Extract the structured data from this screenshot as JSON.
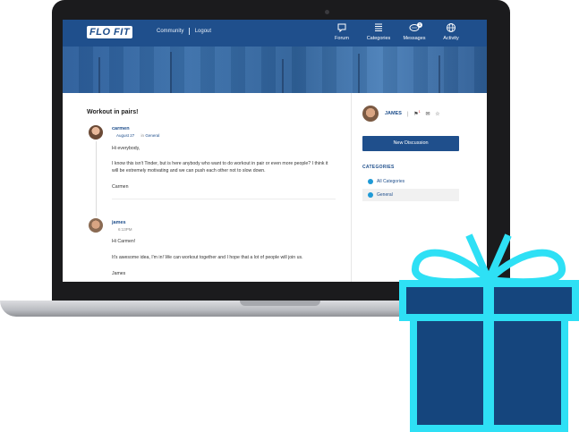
{
  "brand": {
    "logo": "FLO FIT"
  },
  "topnav": {
    "community": "Community",
    "logout": "Logout"
  },
  "iconnav": [
    {
      "label": "Forum",
      "icon": "chat-bubble-icon"
    },
    {
      "label": "Categories",
      "icon": "list-icon"
    },
    {
      "label": "Messages",
      "icon": "messages-icon",
      "badge": "1"
    },
    {
      "label": "Activity",
      "icon": "globe-icon"
    }
  ],
  "thread": {
    "title": "Workout in pairs!",
    "posts": [
      {
        "author": "carmen",
        "date": "August 27",
        "in_word": "in",
        "category": "General",
        "lines": [
          "Hi everybody,",
          "I know this isn't Tinder, but is here anybody who want to do workout in pair or even more people? I think it",
          "will be extremely motivating and we can push each other not to slow down.",
          "Carmen"
        ]
      },
      {
        "author": "james",
        "date": "6:13PM",
        "lines": [
          "Hi Carmen!",
          "It's awesome idea, I'm in! We can workout together and I hope that a lot of people will join us.",
          "James"
        ]
      }
    ]
  },
  "sidebar": {
    "user": "JAMES",
    "notif_count": "1",
    "new_discussion": "New Discussion",
    "categories_heading": "CATEGORIES",
    "categories": [
      {
        "label": "All Categories",
        "active": false
      },
      {
        "label": "General",
        "active": true
      }
    ]
  },
  "colors": {
    "brand_blue": "#1f4f8c",
    "gift_blue": "#15457d",
    "ribbon": "#2ee0f5"
  }
}
